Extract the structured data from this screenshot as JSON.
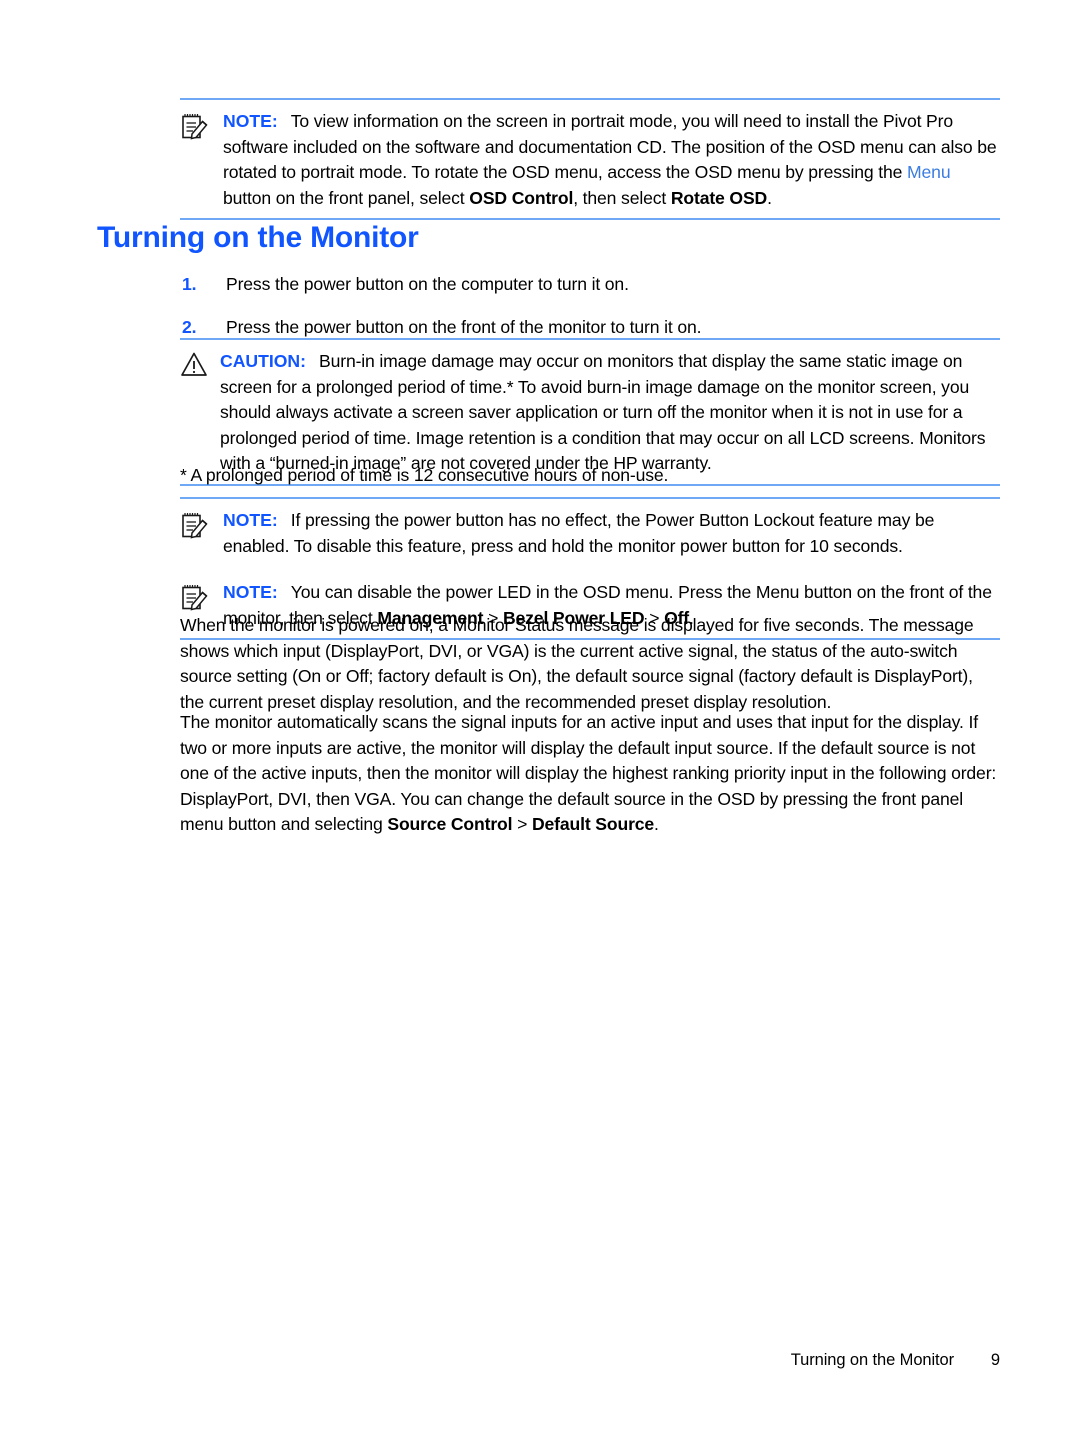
{
  "colors": {
    "heading_blue": "#1155ff",
    "rule_blue": "#6fa8f5",
    "link_blue": "#3b7de0",
    "text_black": "#000000",
    "page_background": "#ffffff"
  },
  "notes": {
    "pivot_pro": {
      "label": "NOTE:",
      "icon": "note-pad-pencil-icon",
      "text_part1": "To view information on the screen in portrait mode, you will need to install the Pivot Pro software included on the software and documentation CD. The position of the OSD menu can also be rotated to portrait mode. To rotate the OSD menu, access the OSD menu by pressing the ",
      "link_menu": "Menu",
      "text_part2": " button on the front panel, select ",
      "bold_osd_control": "OSD Control",
      "text_part3": ", then select ",
      "bold_rotate_osd": "Rotate OSD",
      "text_part4": "."
    },
    "power_button_lockout": {
      "label": "NOTE:",
      "icon": "note-pad-pencil-icon",
      "text": "If pressing the power button has no effect, the Power Button Lockout feature may be enabled. To disable this feature, press and hold the monitor power button for 10 seconds."
    },
    "power_led": {
      "label": "NOTE:",
      "icon": "note-pad-pencil-icon",
      "text_part1": "You can disable the power LED in the OSD menu. Press the Menu button on the front of the monitor, then select ",
      "bold_management": "Management",
      "text_sep1": " > ",
      "bold_bezel": "Bezel Power LED",
      "text_sep2": " > ",
      "bold_off": "Off",
      "text_part2": "."
    }
  },
  "caution": {
    "label": "CAUTION:",
    "icon": "warning-triangle-icon",
    "text": "Burn-in image damage may occur on monitors that display the same static image on screen for a prolonged period of time.* To avoid burn-in image damage on the monitor screen, you should always activate a screen saver application or turn off the monitor when it is not in use for a prolonged period of time. Image retention is a condition that may occur on all LCD screens. Monitors with a “burned-in image” are not covered under the HP warranty."
  },
  "heading": {
    "title": "Turning on the Monitor"
  },
  "steps": [
    {
      "number": "1.",
      "text": "Press the power button on the computer to turn it on."
    },
    {
      "number": "2.",
      "text": "Press the power button on the front of the monitor to turn it on."
    }
  ],
  "footnote": {
    "text": "* A prolonged period of time is 12 consecutive hours of non-use."
  },
  "paragraphs": {
    "monitor_status": "When the monitor is powered on, a Monitor Status message is displayed for five seconds. The message shows which input (DisplayPort, DVI, or VGA) is the current active signal, the status of the auto-switch source setting (On or Off; factory default is On), the default source signal (factory default is DisplayPort), the current preset display resolution, and the recommended preset display resolution.",
    "auto_scan_part1": "The monitor automatically scans the signal inputs for an active input and uses that input for the display. If two or more inputs are active, the monitor will display the default input source. If the default source is not one of the active inputs, then the monitor will display the highest ranking priority input in the following order: DisplayPort, DVI, then VGA. You can change the default source in the OSD by pressing the front panel menu button and selecting ",
    "auto_scan_bold1": "Source Control",
    "auto_scan_sep": " > ",
    "auto_scan_bold2": "Default Source",
    "auto_scan_part2": "."
  },
  "footer": {
    "title": "Turning on the Monitor",
    "page_number": "9"
  }
}
